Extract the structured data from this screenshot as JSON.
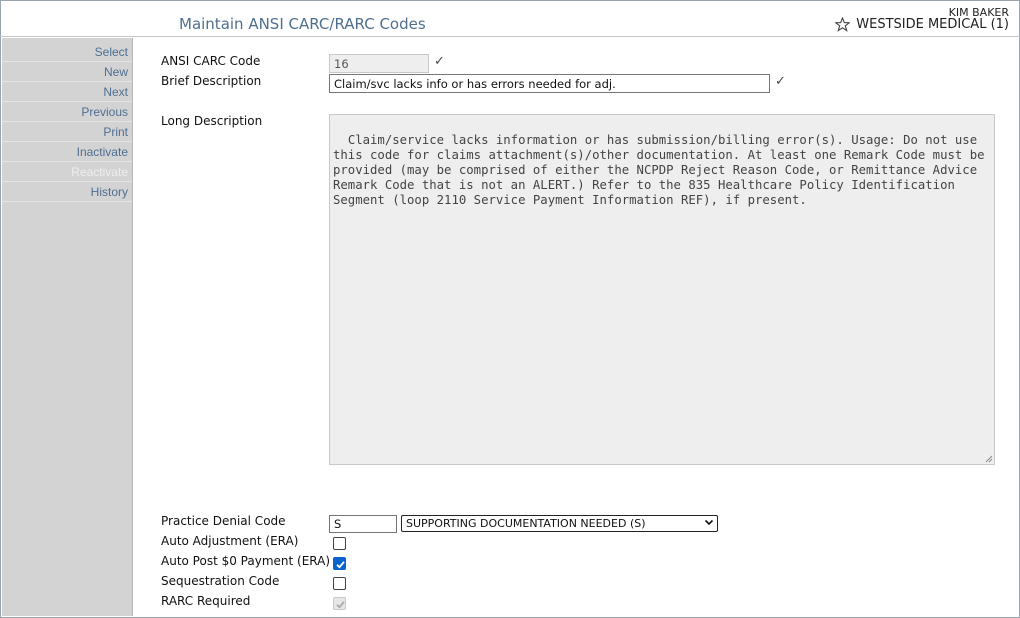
{
  "header": {
    "title": "Maintain ANSI CARC/RARC Codes",
    "user": "KIM BAKER",
    "practice": "WESTSIDE MEDICAL (1)"
  },
  "sidebar": {
    "items": [
      {
        "label": "Select",
        "enabled": true
      },
      {
        "label": "New",
        "enabled": true
      },
      {
        "label": "Next",
        "enabled": true
      },
      {
        "label": "Previous",
        "enabled": true
      },
      {
        "label": "Print",
        "enabled": true
      },
      {
        "label": "Inactivate",
        "enabled": true
      },
      {
        "label": "Reactivate",
        "enabled": false
      },
      {
        "label": "History",
        "enabled": true
      }
    ]
  },
  "form": {
    "carc_code_label": "ANSI CARC Code",
    "carc_code_value": "16",
    "brief_label": "Brief Description",
    "brief_value": "Claim/svc lacks info or has errors needed for adj.",
    "long_label": "Long Description",
    "long_value": "Claim/service lacks information or has submission/billing error(s). Usage: Do not use this code for claims attachment(s)/other documentation. At least one Remark Code must be provided (may be comprised of either the NCPDP Reject Reason Code, or Remittance Advice Remark Code that is not an ALERT.) Refer to the 835 Healthcare Policy Identification Segment (loop 2110 Service Payment Information REF), if present.",
    "denial_label": "Practice Denial Code",
    "denial_code": "S",
    "denial_selected": "SUPPORTING DOCUMENTATION NEEDED (S)",
    "auto_adjust_label": "Auto Adjustment (ERA)",
    "auto_adjust_checked": false,
    "auto_post_label": "Auto Post $0 Payment (ERA)",
    "auto_post_checked": true,
    "sequestration_label": "Sequestration Code",
    "sequestration_checked": false,
    "rarc_label": "RARC Required",
    "rarc_checked": true
  },
  "icons": {
    "favorite": "star-icon",
    "valid": "checkmark-icon"
  }
}
